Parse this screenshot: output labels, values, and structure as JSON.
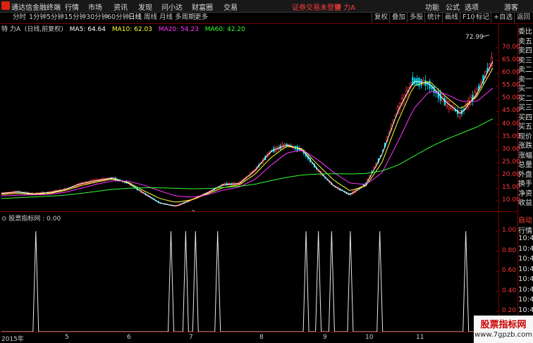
{
  "app": {
    "name": "通达信金融终端"
  },
  "menu": [
    "行情",
    "市场",
    "资讯",
    "发现",
    "问小达",
    "财富圈",
    "交易"
  ],
  "warning": "证券交易未登录",
  "stock_tag": "特 力A",
  "right_menu": [
    "功能",
    "公式",
    "选项",
    "游客"
  ],
  "periods": [
    "分时",
    "1分钟",
    "5分钟",
    "15分钟",
    "30分钟",
    "60分钟",
    "日线",
    "周线",
    "月线",
    "多周期",
    "更多"
  ],
  "active_period": "日线",
  "toolbar_right": [
    "复权",
    "叠加",
    "多股",
    "统计",
    "画线",
    "F10",
    "标记",
    "+自选",
    "返回"
  ],
  "chart_header": {
    "title": "特 力A",
    "mode": "(日线,前复权)",
    "ma5": "MA5: 64.64",
    "ma10": "MA10: 62.03",
    "ma20": "MA20: 54.23",
    "ma60": "MA60: 42.20"
  },
  "indicator_header": "股票指标网 : 0.00",
  "annotations": {
    "high": "72.99",
    "low": "6.70"
  },
  "side_panel": [
    "委比",
    "卖五",
    "卖四",
    "卖三",
    "卖二",
    "卖一",
    "买一",
    "买二",
    "买三",
    "买四",
    "买五",
    "现价",
    "涨跌",
    "涨幅",
    "总量",
    "外盘",
    "换手",
    "净资",
    "收益",
    "自动",
    "行情",
    "10:45",
    "10:45",
    "10:45",
    "10:45",
    "10:45",
    "10:45",
    "10:45",
    "10:45"
  ],
  "x_labels": [
    "2015年",
    "5",
    "6",
    "7",
    "8",
    "9",
    "10",
    "11"
  ],
  "watermark": {
    "line1": "股票指标网",
    "line2": "www.7gpzb.com"
  },
  "colors": {
    "up": "#ff3b3b",
    "down": "#00e5ff",
    "ma5": "#ffffff",
    "ma10": "#ffff33",
    "ma20": "#ff33ff",
    "ma60": "#33ff33",
    "axis": "#7a0000"
  },
  "chart_data": [
    {
      "type": "candlestick",
      "title": "",
      "y_axis": {
        "ticks": [
          70.0,
          65.0,
          60.0,
          55.0,
          50.0,
          45.0,
          40.0,
          35.0,
          30.0,
          25.0,
          20.0,
          15.0,
          10.0
        ],
        "range": [
          6.0,
          76.0
        ]
      },
      "x_axis": {
        "labels": [
          "2015年",
          "5",
          "6",
          "7",
          "8",
          "9",
          "10",
          "11"
        ]
      },
      "series": [
        {
          "name": "MA5",
          "values": [
            13.0,
            13.6,
            12.8,
            13.3,
            14.5,
            16.8,
            18.0,
            19.0,
            17.0,
            13.0,
            9.2,
            8.0,
            10.5,
            13.2,
            16.5,
            16.8,
            22.0,
            29.5,
            32.0,
            30.0,
            22.0,
            15.8,
            12.5,
            16.5,
            28.0,
            45.0,
            57.0,
            56.0,
            49.0,
            44.0,
            52.0,
            64.6
          ]
        },
        {
          "name": "MA10",
          "values": [
            12.6,
            13.0,
            12.7,
            13.0,
            14.1,
            16.0,
            17.5,
            18.6,
            17.3,
            14.0,
            11.0,
            9.5,
            10.5,
            12.8,
            15.3,
            16.3,
            20.5,
            27.0,
            31.5,
            30.4,
            24.0,
            18.0,
            14.0,
            16.0,
            25.0,
            41.0,
            55.0,
            57.0,
            51.0,
            46.0,
            51.0,
            62.0
          ]
        },
        {
          "name": "MA20",
          "values": [
            12.0,
            12.3,
            12.4,
            12.6,
            13.4,
            15.0,
            16.6,
            17.9,
            17.8,
            16.2,
            14.0,
            12.0,
            11.5,
            12.5,
            14.3,
            15.5,
            18.5,
            24.0,
            28.8,
            30.0,
            26.0,
            21.0,
            17.0,
            16.5,
            21.0,
            33.0,
            46.0,
            53.0,
            52.0,
            49.0,
            49.0,
            54.2
          ]
        },
        {
          "name": "MA60",
          "values": [
            11.0,
            11.3,
            11.6,
            11.9,
            12.3,
            13.0,
            13.8,
            14.6,
            15.0,
            15.2,
            15.2,
            15.0,
            14.8,
            14.9,
            15.3,
            15.8,
            16.6,
            18.0,
            19.3,
            20.2,
            20.6,
            20.7,
            20.6,
            20.8,
            21.8,
            24.0,
            27.5,
            31.0,
            34.0,
            36.5,
            39.0,
            42.2
          ]
        }
      ],
      "high": 72.99,
      "low": 6.7
    },
    {
      "type": "line",
      "title": "",
      "y_axis": {
        "ticks": [
          1.0,
          0.8,
          0.6,
          0.4,
          0.2,
          0.0
        ],
        "range": [
          0,
          1.1
        ]
      },
      "spikes_at_fraction": [
        0.07,
        0.345,
        0.375,
        0.395,
        0.44,
        0.62,
        0.645,
        0.672,
        0.71,
        0.77,
        0.945
      ]
    }
  ]
}
